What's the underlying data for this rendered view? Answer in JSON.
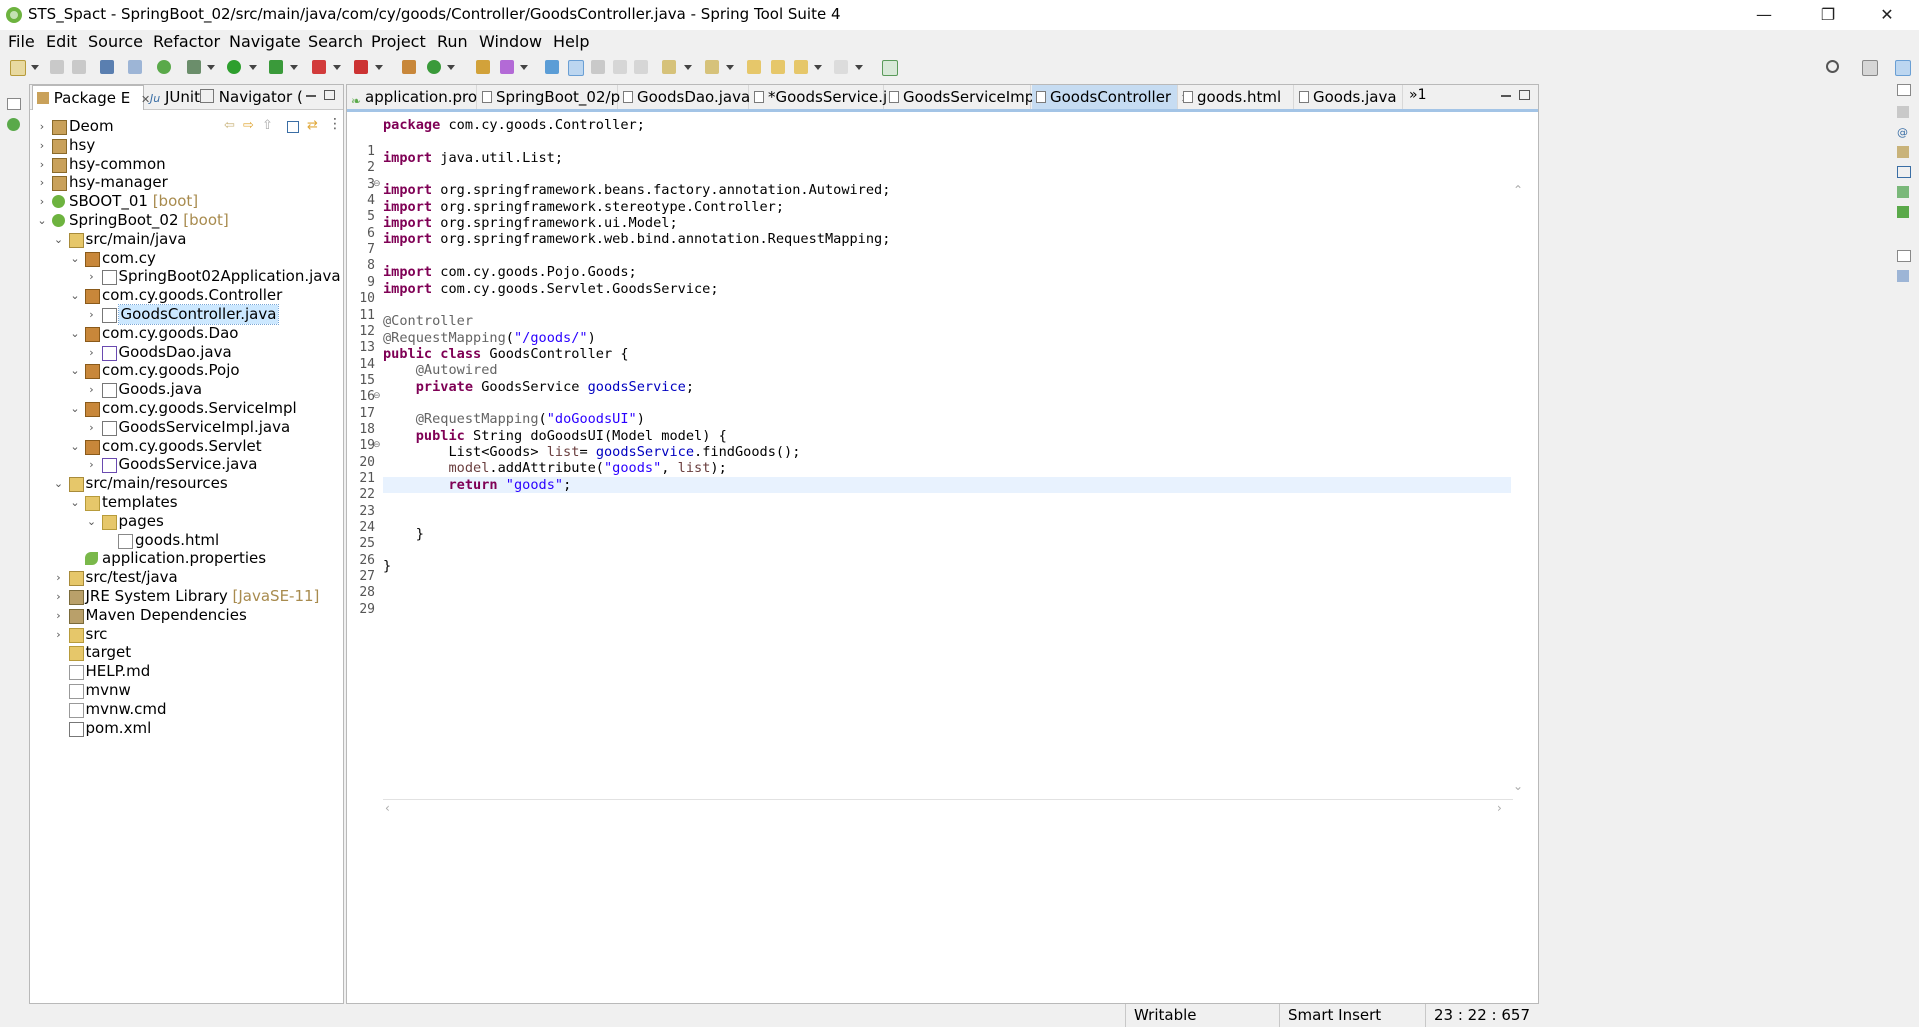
{
  "window": {
    "title": "STS_Spact - SpringBoot_02/src/main/java/com/cy/goods/Controller/GoodsController.java - Spring Tool Suite 4",
    "minimize": "—",
    "restore": "❐",
    "close": "✕"
  },
  "menu": [
    "File",
    "Edit",
    "Source",
    "Refactor",
    "Navigate",
    "Search",
    "Project",
    "Run",
    "Window",
    "Help"
  ],
  "left_panel": {
    "tabs": [
      "Package E",
      "JUnit",
      "Navigator ("
    ],
    "tab_close": "✕",
    "tree": [
      {
        "label": "Deom",
        "decor": "",
        "icon": "project-icon"
      },
      {
        "label": "hsy",
        "decor": "",
        "icon": "project-icon"
      },
      {
        "label": "hsy-common",
        "decor": "",
        "icon": "project-icon"
      },
      {
        "label": "hsy-manager",
        "decor": "",
        "icon": "project-icon"
      },
      {
        "label": "SBOOT_01",
        "decor": "[boot]",
        "icon": "boot-project-icon"
      },
      {
        "label": "SpringBoot_02",
        "decor": "[boot]",
        "icon": "boot-project-icon"
      },
      {
        "label": "src/main/java",
        "decor": "",
        "icon": "source-folder-icon"
      },
      {
        "label": "com.cy",
        "decor": "",
        "icon": "package-icon"
      },
      {
        "label": "SpringBoot02Application.java",
        "decor": "",
        "icon": "java-file-icon"
      },
      {
        "label": "com.cy.goods.Controller",
        "decor": "",
        "icon": "package-icon"
      },
      {
        "label": "GoodsController.java",
        "decor": "",
        "icon": "java-file-icon"
      },
      {
        "label": "com.cy.goods.Dao",
        "decor": "",
        "icon": "package-icon"
      },
      {
        "label": "GoodsDao.java",
        "decor": "",
        "icon": "java-interface-icon"
      },
      {
        "label": "com.cy.goods.Pojo",
        "decor": "",
        "icon": "package-icon"
      },
      {
        "label": "Goods.java",
        "decor": "",
        "icon": "java-file-icon"
      },
      {
        "label": "com.cy.goods.ServiceImpl",
        "decor": "",
        "icon": "package-icon"
      },
      {
        "label": "GoodsServiceImpl.java",
        "decor": "",
        "icon": "java-file-icon"
      },
      {
        "label": "com.cy.goods.Servlet",
        "decor": "",
        "icon": "package-icon"
      },
      {
        "label": "GoodsService.java",
        "decor": "",
        "icon": "java-interface-icon"
      },
      {
        "label": "src/main/resources",
        "decor": "",
        "icon": "source-folder-icon"
      },
      {
        "label": "templates",
        "decor": "",
        "icon": "folder-icon"
      },
      {
        "label": "pages",
        "decor": "",
        "icon": "folder-icon"
      },
      {
        "label": "goods.html",
        "decor": "",
        "icon": "html-file-icon"
      },
      {
        "label": "application.properties",
        "decor": "",
        "icon": "properties-leaf-icon"
      },
      {
        "label": "src/test/java",
        "decor": "",
        "icon": "source-folder-icon"
      },
      {
        "label": "JRE System Library",
        "decor": "[JavaSE-11]",
        "icon": "library-icon"
      },
      {
        "label": "Maven Dependencies",
        "decor": "",
        "icon": "library-icon"
      },
      {
        "label": "src",
        "decor": "",
        "icon": "folder-icon"
      },
      {
        "label": "target",
        "decor": "",
        "icon": "folder-icon"
      },
      {
        "label": "HELP.md",
        "decor": "",
        "icon": "text-file-icon"
      },
      {
        "label": "mvnw",
        "decor": "",
        "icon": "text-file-icon"
      },
      {
        "label": "mvnw.cmd",
        "decor": "",
        "icon": "text-file-icon"
      },
      {
        "label": "pom.xml",
        "decor": "",
        "icon": "xml-file-icon"
      }
    ]
  },
  "editor": {
    "tabs": [
      {
        "label": "application.pro",
        "active": false
      },
      {
        "label": "SpringBoot_02/p",
        "active": false
      },
      {
        "label": "GoodsDao.java",
        "active": false
      },
      {
        "label": "*GoodsService.j",
        "active": false
      },
      {
        "label": "GoodsServiceImp",
        "active": false
      },
      {
        "label": "GoodsController",
        "active": true
      },
      {
        "label": "goods.html",
        "active": false
      },
      {
        "label": "Goods.java",
        "active": false
      }
    ],
    "overflow": "»1",
    "current_line": 23,
    "lines": [
      "package com.cy.goods.Controller;",
      "",
      "import java.util.List;",
      "",
      "import org.springframework.beans.factory.annotation.Autowired;",
      "import org.springframework.stereotype.Controller;",
      "import org.springframework.ui.Model;",
      "import org.springframework.web.bind.annotation.RequestMapping;",
      "",
      "import com.cy.goods.Pojo.Goods;",
      "import com.cy.goods.Servlet.GoodsService;",
      "",
      "@Controller",
      "@RequestMapping(\"/goods/\")",
      "public class GoodsController {",
      "    @Autowired",
      "    private GoodsService goodsService;",
      "",
      "    @RequestMapping(\"doGoodsUI\")",
      "    public String doGoodsUI(Model model) {",
      "        List<Goods> list= goodsService.findGoods();",
      "        model.addAttribute(\"goods\", list);",
      "        return \"goods\";",
      "",
      "",
      "    }",
      "",
      "}",
      ""
    ]
  },
  "status": {
    "writable": "Writable",
    "insert_mode": "Smart Insert",
    "position": "23 : 22 : 657"
  },
  "colors": {
    "keyword": "#7f0055",
    "annotation": "#646464",
    "string": "#2a00ff",
    "field": "#0000c0",
    "selection": "#cce8ff",
    "current_line": "#e8f2fe",
    "active_tab": "#c6dcf2"
  }
}
